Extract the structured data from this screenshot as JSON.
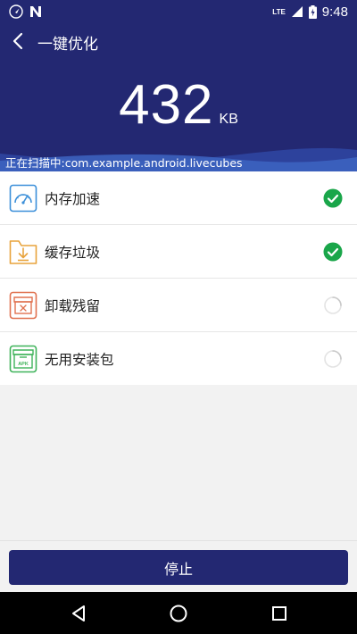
{
  "status_bar": {
    "left_icons": [
      "navigation-notification-icon",
      "n-notification-icon"
    ],
    "network": "LTE",
    "time": "9:48"
  },
  "toolbar": {
    "title": "一键优化"
  },
  "scan": {
    "size_value": "432",
    "size_unit": "KB",
    "status_text": "正在扫描中:com.example.android.livecubes"
  },
  "items": [
    {
      "label": "内存加速",
      "icon": "speedometer-icon",
      "icon_color": "#3b8fd9",
      "state": "done"
    },
    {
      "label": "缓存垃圾",
      "icon": "folder-download-icon",
      "icon_color": "#e8a33c",
      "state": "done"
    },
    {
      "label": "卸载残留",
      "icon": "uninstall-box-icon",
      "icon_color": "#e0714f",
      "state": "loading"
    },
    {
      "label": "无用安装包",
      "icon": "apk-package-icon",
      "icon_color": "#3fb35a",
      "state": "loading"
    }
  ],
  "actions": {
    "stop_label": "停止"
  },
  "colors": {
    "primary": "#232872",
    "check": "#1aa64a"
  }
}
